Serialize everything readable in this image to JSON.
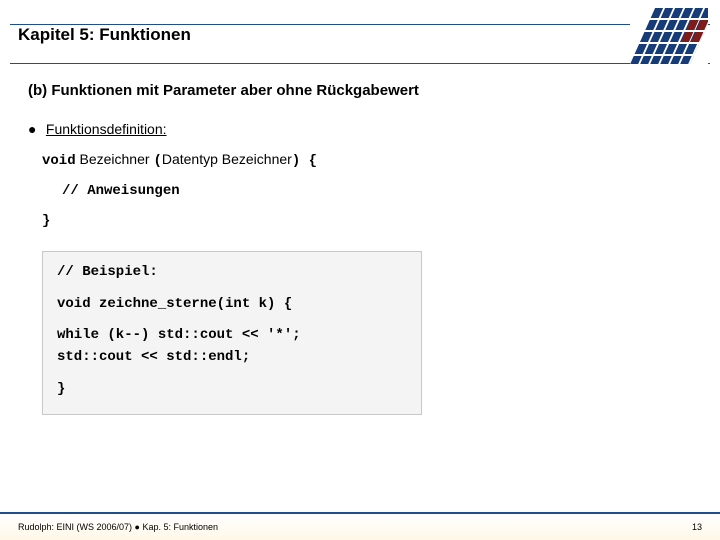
{
  "header": {
    "title": "Kapitel 5: Funktionen"
  },
  "content": {
    "subheading": "(b) Funktionen mit Parameter aber ohne Rückgabewert",
    "bullet_label": "Funktionsdefinition:",
    "syntax": {
      "kw_void": "void",
      "after_void": " Bezeichner ",
      "paren_open": "(",
      "params": "Datentyp Bezeichner",
      "paren_close": ")",
      "brace_open": " {",
      "comment_body": "// Anweisungen",
      "brace_close": "}"
    },
    "example": {
      "l1": "// Beispiel:",
      "l2": "void zeichne_sterne(int k) {",
      "l3": "  while (k--) std::cout << '*';",
      "l4": "  std::cout << std::endl;",
      "l5": "}"
    }
  },
  "footer": {
    "left": "Rudolph: EINI (WS 2006/07)  ●  Kap. 5: Funktionen",
    "right": "13"
  }
}
